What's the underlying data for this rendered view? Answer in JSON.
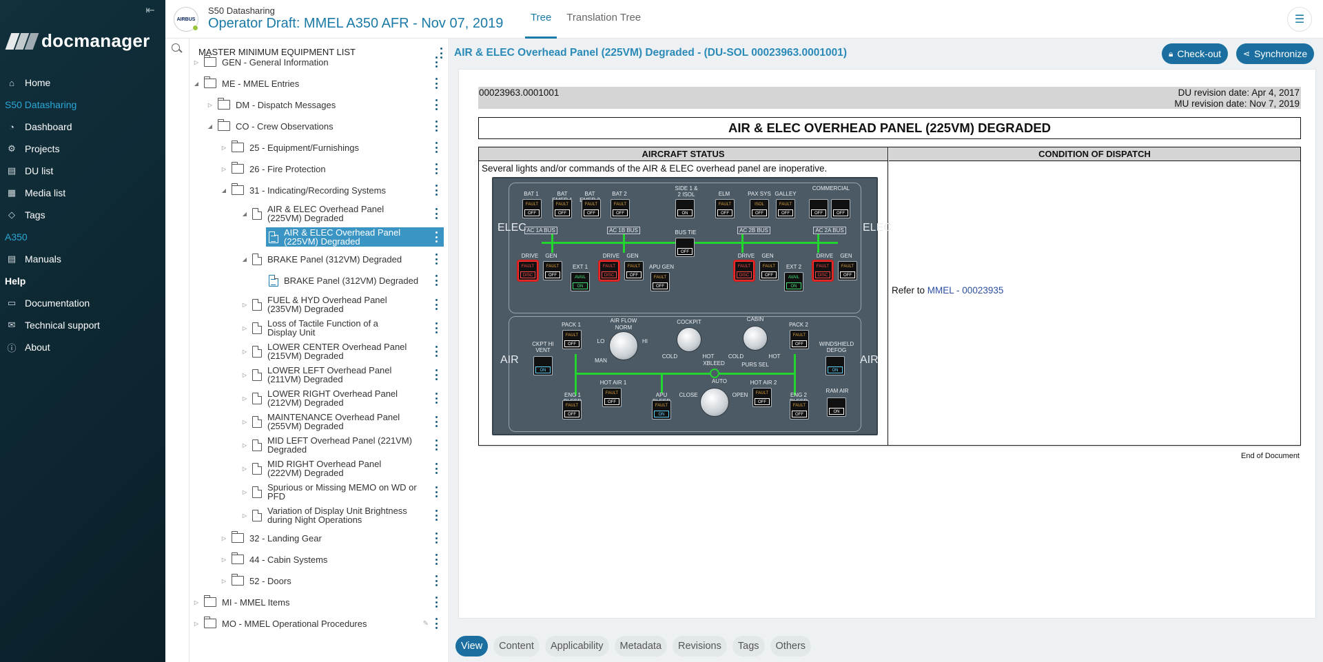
{
  "sidebar": {
    "brand": "docmanager",
    "items": [
      {
        "label": "Home",
        "icon": "home-icon"
      },
      {
        "section": "S50 Datasharing"
      },
      {
        "label": "Dashboard",
        "icon": "dashboard-icon"
      },
      {
        "label": "Projects",
        "icon": "projects-icon"
      },
      {
        "label": "DU list",
        "icon": "list-icon"
      },
      {
        "label": "Media list",
        "icon": "media-icon"
      },
      {
        "label": "Tags",
        "icon": "tag-icon"
      },
      {
        "section": "A350"
      },
      {
        "label": "Manuals",
        "icon": "manuals-icon"
      },
      {
        "section": "Help"
      },
      {
        "label": "Documentation",
        "icon": "documentation-icon"
      },
      {
        "label": "Technical support",
        "icon": "support-icon"
      },
      {
        "label": "About",
        "icon": "info-icon"
      }
    ]
  },
  "header": {
    "badge": "AIRBUS",
    "subtitle": "S50 Datasharing",
    "title": "Operator Draft: MMEL A350 AFR - Nov 07, 2019",
    "tabs": [
      "Tree",
      "Translation Tree"
    ]
  },
  "tree": {
    "heading": "MASTER MINIMUM EQUIPMENT LIST",
    "nodes": [
      {
        "label": "GEN - General Information"
      },
      {
        "label": "ME - MMEL Entries"
      },
      {
        "label": "DM - Dispatch Messages"
      },
      {
        "label": "CO - Crew Observations"
      },
      {
        "label": "25 - Equipment/Furnishings"
      },
      {
        "label": "26 - Fire Protection"
      },
      {
        "label": "31 - Indicating/Recording Systems"
      },
      {
        "label": "AIR & ELEC Overhead Panel (225VM) Degraded"
      },
      {
        "label": "AIR & ELEC Overhead Panel (225VM) Degraded"
      },
      {
        "label": "BRAKE Panel (312VM) Degraded"
      },
      {
        "label": "BRAKE Panel (312VM) Degraded"
      },
      {
        "label": "FUEL & HYD Overhead Panel (235VM) Degraded"
      },
      {
        "label": "Loss of Tactile Function of a Display Unit"
      },
      {
        "label": "LOWER CENTER Overhead Panel (215VM) Degraded"
      },
      {
        "label": "LOWER LEFT Overhead Panel (211VM) Degraded"
      },
      {
        "label": "LOWER RIGHT Overhead Panel (212VM) Degraded"
      },
      {
        "label": "MAINTENANCE Overhead Panel (255VM) Degraded"
      },
      {
        "label": "MID LEFT Overhead Panel (221VM) Degraded"
      },
      {
        "label": "MID RIGHT Overhead Panel (222VM) Degraded"
      },
      {
        "label": "Spurious or Missing MEMO on WD or PFD"
      },
      {
        "label": "Variation of Display Unit Brightness during Night Operations"
      },
      {
        "label": "32 - Landing Gear"
      },
      {
        "label": "44 - Cabin Systems"
      },
      {
        "label": "52 - Doors"
      },
      {
        "label": "MI - MMEL Items"
      },
      {
        "label": "MO - MMEL Operational Procedures"
      }
    ]
  },
  "content": {
    "title": "AIR & ELEC Overhead Panel (225VM) Degraded - (DU-SOL 00023963.0001001)",
    "checkout_label": "Check-out",
    "synchronize_label": "Synchronize",
    "du_id": "00023963.0001001",
    "du_revision": "DU revision date: Apr 4, 2017",
    "mu_revision": "MU revision date: Nov 7, 2019",
    "heading": "AIR & ELEC OVERHEAD PANEL (225VM) DEGRADED",
    "col_status": "AIRCRAFT STATUS",
    "col_dispatch": "CONDITION OF DISPATCH",
    "status_text": "Several lights and/or commands of the AIR & ELEC overhead panel are inoperative.",
    "dispatch_prefix": "Refer to",
    "dispatch_link": "MMEL - 00023935",
    "end": "End of Document"
  },
  "bottom_tabs": [
    "View",
    "Content",
    "Applicability",
    "Metadata",
    "Revisions",
    "Tags",
    "Others"
  ],
  "panel": {
    "elec": "ELEC",
    "air": "AIR",
    "labels": [
      "BAT 1",
      "BAT EMER 1",
      "BAT EMER 2",
      "BAT 2",
      "SIDE 1 & 2 ISOL",
      "ELM",
      "PAX SYS",
      "GALLEY",
      "COMMERCIAL",
      "AC 1A BUS",
      "AC 1B BUS",
      "BUS TIE",
      "AC 2B BUS",
      "AC 2A BUS",
      "DRIVE",
      "GEN",
      "EXT 1",
      "APU GEN",
      "EXT 2",
      "PACK 1",
      "AIR FLOW",
      "NORM",
      "COCKPIT",
      "CABIN",
      "PACK 2",
      "CKPT HI VENT",
      "WINDSHIELD DEFOG",
      "XBLEED",
      "HOT AIR 1",
      "HOT AIR 2",
      "ENG 1 BLEED",
      "APU BLEED",
      "ENG 2 BLEED",
      "RAM AIR",
      "CLOSE",
      "AUTO",
      "OPEN",
      "LO",
      "HI",
      "MAN",
      "COLD",
      "HOT",
      "PURS SEL"
    ],
    "fault": "FAULT",
    "off": "OFF",
    "on": "ON",
    "disc": "DISC",
    "isol": "ISOL",
    "avail": "AVAIL"
  }
}
